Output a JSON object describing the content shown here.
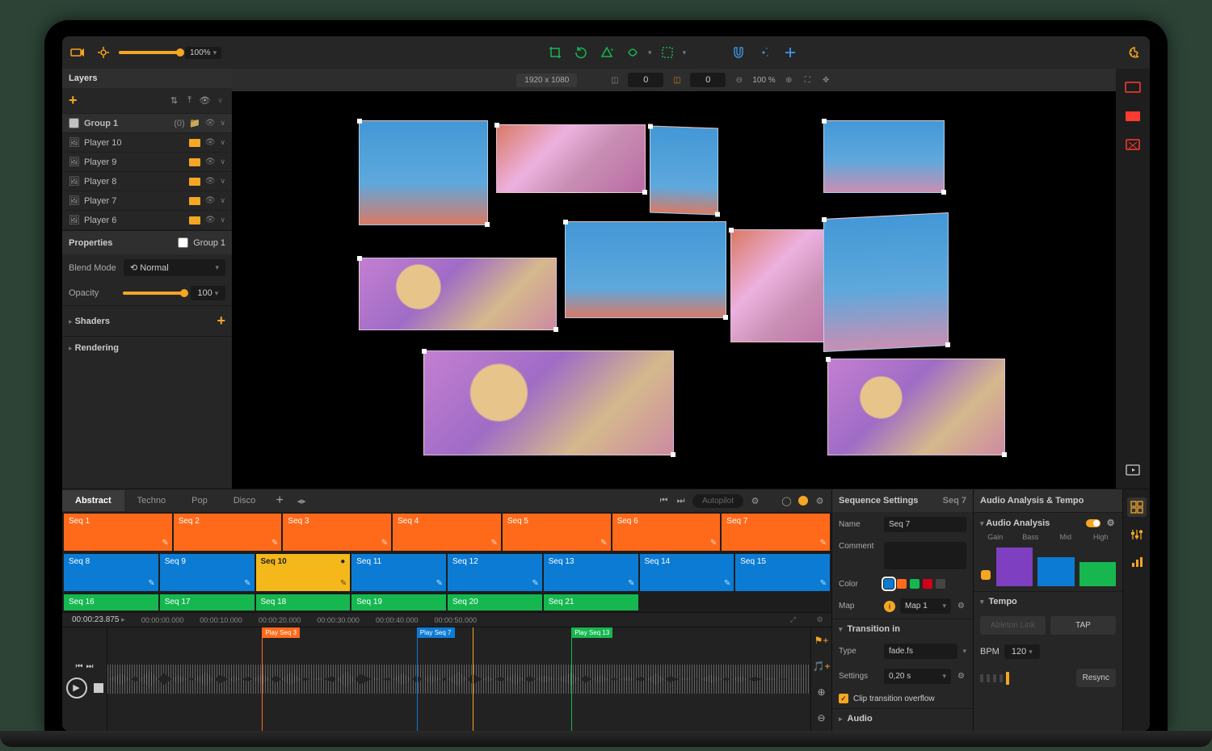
{
  "toolbar": {
    "brightness": "100%",
    "theme_icon": "palette-icon"
  },
  "layers": {
    "title": "Layers",
    "group": {
      "name": "Group 1",
      "count": "(0)"
    },
    "items": [
      {
        "name": "Player 10"
      },
      {
        "name": "Player 9"
      },
      {
        "name": "Player 8"
      },
      {
        "name": "Player 7"
      },
      {
        "name": "Player 6"
      }
    ]
  },
  "properties": {
    "title": "Properties",
    "group_ref": "Group 1",
    "blend_mode": {
      "label": "Blend Mode",
      "value": "Normal"
    },
    "opacity": {
      "label": "Opacity",
      "value": "100"
    },
    "sections": {
      "shaders": "Shaders",
      "rendering": "Rendering"
    }
  },
  "viewport": {
    "resolution": "1920 x 1080",
    "grid_x": "0",
    "grid_y": "0",
    "zoom": "100 %"
  },
  "sequencer": {
    "tabs": [
      "Abstract",
      "Techno",
      "Pop",
      "Disco"
    ],
    "autopilot": "Autopilot",
    "row1": [
      "Seq 1",
      "Seq 2",
      "Seq 3",
      "Seq 4",
      "Seq 5",
      "Seq 6",
      "Seq 7"
    ],
    "row2": [
      "Seq 8",
      "Seq 9",
      "Seq 10",
      "Seq 11",
      "Seq 12",
      "Seq 13",
      "Seq 14",
      "Seq 15"
    ],
    "row3": [
      "Seq 16",
      "Seq 17",
      "Seq 18",
      "Seq 19",
      "Seq 20",
      "Seq 21"
    ]
  },
  "timeline": {
    "current": "00:00:23.875",
    "ticks": [
      "00:00:00.000",
      "00:00:10.000",
      "00:00:20.000",
      "00:00:30.000",
      "00:00:40.000",
      "00:00:50.000"
    ],
    "markers": [
      {
        "label": "Play Seq 3",
        "color": "orange",
        "pos_pct": 22
      },
      {
        "label": "Play Seq 7",
        "color": "blue",
        "pos_pct": 44
      },
      {
        "label": "Play Seq 13",
        "color": "green",
        "pos_pct": 66
      }
    ],
    "playhead_pct": 52
  },
  "seq_settings": {
    "title": "Sequence Settings",
    "seq_ref": "Seq 7",
    "name_label": "Name",
    "name_value": "Seq 7",
    "comment_label": "Comment",
    "color_label": "Color",
    "map_label": "Map",
    "map_value": "Map 1",
    "transition_title": "Transition in",
    "type_label": "Type",
    "type_value": "fade.fs",
    "settings_label": "Settings",
    "settings_value": "0,20 s",
    "clip_overflow": "Clip transition overflow",
    "audio_section": "Audio"
  },
  "audio": {
    "title": "Audio Analysis & Tempo",
    "analysis_title": "Audio Analysis",
    "bands": [
      "Gain",
      "Bass",
      "Mid",
      "High"
    ],
    "band_heights": [
      24,
      48,
      36,
      30
    ],
    "band_colors": [
      "#f5a623",
      "#7e3fc0",
      "#0c7bd4",
      "#16b74f"
    ],
    "tempo_title": "Tempo",
    "ableton": "Ableton Link",
    "tap": "TAP",
    "bpm_label": "BPM",
    "bpm_value": "120",
    "resync": "Resync"
  }
}
